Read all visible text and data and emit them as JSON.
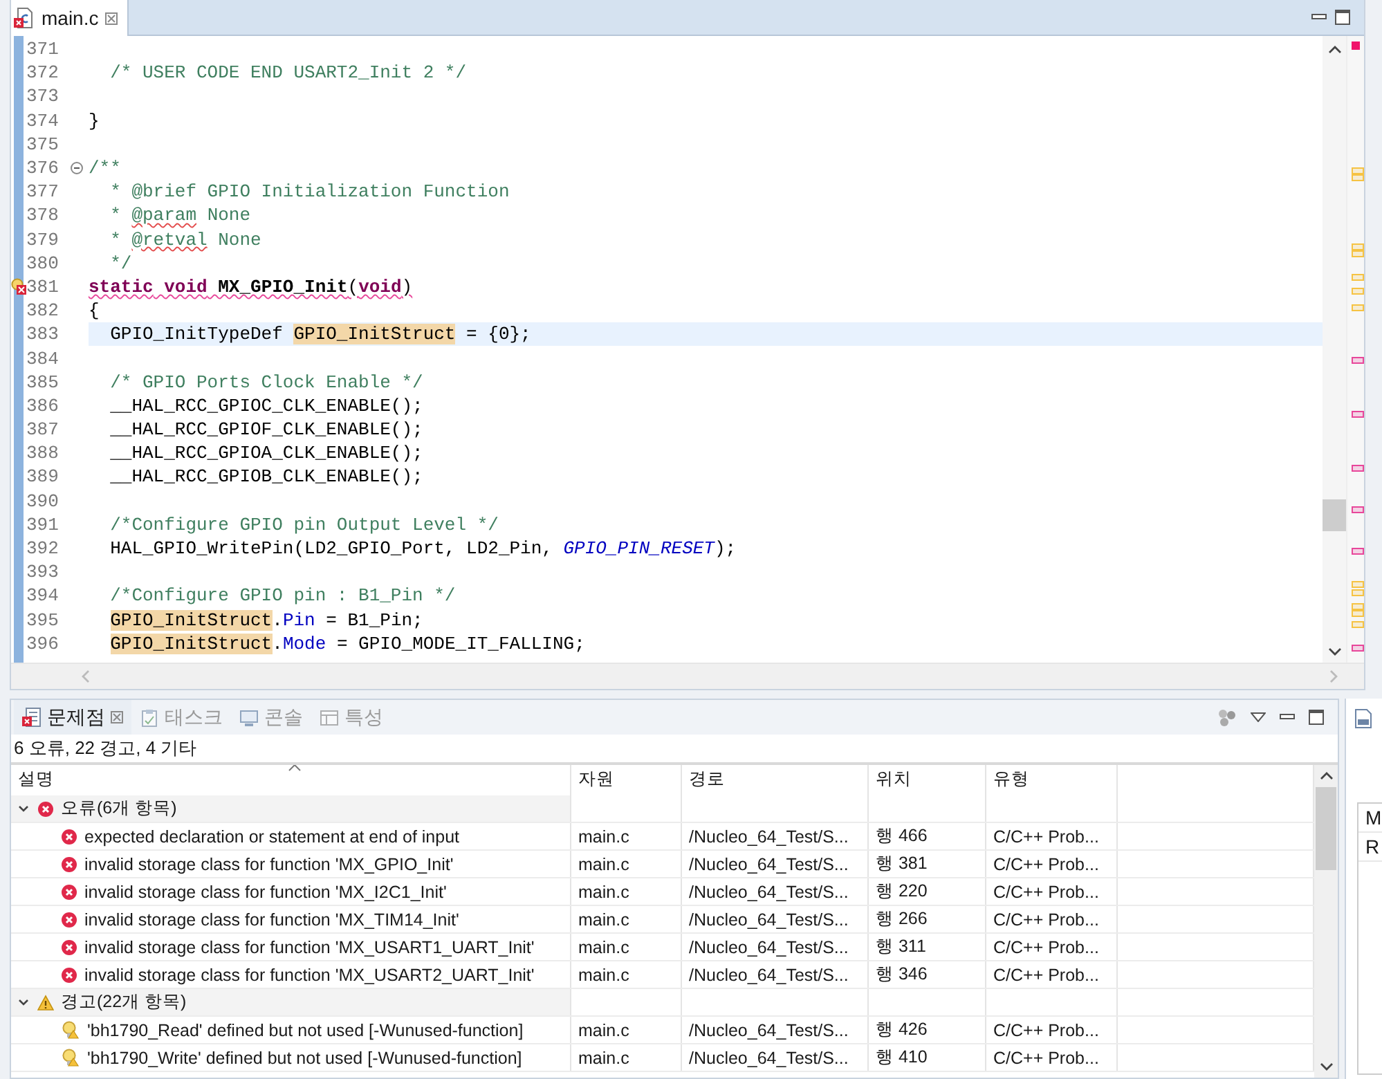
{
  "editor": {
    "tab": {
      "title": "main.c",
      "selected": true
    },
    "lines": [
      {
        "number": "371"
      },
      {
        "number": "372",
        "indented": true,
        "tokens": [
          {
            "text": "/* USER CODE END USART2_Init 2 */",
            "kind": "comment"
          }
        ]
      },
      {
        "number": "373"
      },
      {
        "number": "374",
        "indented": false,
        "tokens": [
          {
            "text": "}",
            "kind": "code"
          }
        ]
      },
      {
        "number": "375"
      },
      {
        "number": "376",
        "foldable": true,
        "indented": false,
        "tokens": [
          {
            "text": "/**",
            "kind": "comment"
          }
        ]
      },
      {
        "number": "377",
        "indented": true,
        "tokens": [
          {
            "text": "* @brief GPIO Initialization Function",
            "kind": "comment"
          }
        ]
      },
      {
        "number": "378",
        "indented": true,
        "tokens": [
          {
            "text": "* ",
            "kind": "comment"
          },
          {
            "text": "@param",
            "kind": "misspelled"
          },
          {
            "text": " None",
            "kind": "comment"
          }
        ]
      },
      {
        "number": "379",
        "indented": true,
        "tokens": [
          {
            "text": "* ",
            "kind": "comment"
          },
          {
            "text": "@retval",
            "kind": "misspelled"
          },
          {
            "text": " None",
            "kind": "comment"
          }
        ]
      },
      {
        "number": "380",
        "indented": true,
        "tokens": [
          {
            "text": "*/",
            "kind": "comment"
          }
        ]
      },
      {
        "number": "381",
        "annotation": true,
        "error": true,
        "indented": false,
        "tokens": [
          {
            "text": "static",
            "kind": "keyword"
          },
          {
            "text": " void",
            "kind": "keyword"
          },
          {
            "text": " MX_GPIO_Init",
            "kind": "declaration"
          },
          {
            "text": "(",
            "kind": "code"
          },
          {
            "text": "void",
            "kind": "keyword"
          },
          {
            "text": ")",
            "kind": "code"
          }
        ]
      },
      {
        "number": "382",
        "indented": false,
        "tokens": [
          {
            "text": "{",
            "kind": "code"
          }
        ]
      },
      {
        "number": "383",
        "current": true,
        "indented": true,
        "tokens": [
          {
            "text": "GPIO_InitTypeDef ",
            "kind": "code"
          },
          {
            "text": "GPIO_InitStruct",
            "kind": "occurrence"
          },
          {
            "text": " = {0};",
            "kind": "code"
          }
        ]
      },
      {
        "number": "384"
      },
      {
        "number": "385",
        "indented": true,
        "tokens": [
          {
            "text": "/* GPIO Ports Clock Enable */",
            "kind": "comment"
          }
        ]
      },
      {
        "number": "386",
        "indented": true,
        "tokens": [
          {
            "text": "__HAL_RCC_GPIOC_CLK_ENABLE();",
            "kind": "code"
          }
        ]
      },
      {
        "number": "387",
        "indented": true,
        "tokens": [
          {
            "text": "__HAL_RCC_GPIOF_CLK_ENABLE();",
            "kind": "code"
          }
        ]
      },
      {
        "number": "388",
        "indented": true,
        "tokens": [
          {
            "text": "__HAL_RCC_GPIOA_CLK_ENABLE();",
            "kind": "code"
          }
        ]
      },
      {
        "number": "389",
        "indented": true,
        "tokens": [
          {
            "text": "__HAL_RCC_GPIOB_CLK_ENABLE();",
            "kind": "code"
          }
        ]
      },
      {
        "number": "390"
      },
      {
        "number": "391",
        "indented": true,
        "tokens": [
          {
            "text": "/*Configure GPIO pin Output Level */",
            "kind": "comment"
          }
        ]
      },
      {
        "number": "392",
        "indented": true,
        "tokens": [
          {
            "text": "HAL_GPIO_WritePin(LD2_GPIO_Port, LD2_Pin, ",
            "kind": "code"
          },
          {
            "text": "GPIO_PIN_RESET",
            "kind": "macro"
          },
          {
            "text": ");",
            "kind": "code"
          }
        ]
      },
      {
        "number": "393"
      },
      {
        "number": "394",
        "indented": true,
        "tokens": [
          {
            "text": "/*Configure GPIO pin : B1_Pin */",
            "kind": "comment"
          }
        ]
      },
      {
        "number": "395",
        "indented": true,
        "tokens": [
          {
            "text": "GPIO_InitStruct",
            "kind": "occurrence"
          },
          {
            "text": ".",
            "kind": "code"
          },
          {
            "text": "Pin",
            "kind": "field"
          },
          {
            "text": " = B1_Pin;",
            "kind": "code"
          }
        ]
      },
      {
        "number": "396",
        "indented": true,
        "tokens": [
          {
            "text": "GPIO_InitStruct",
            "kind": "occurrence"
          },
          {
            "text": ".",
            "kind": "code"
          },
          {
            "text": "Mode",
            "kind": "field"
          },
          {
            "text": " = GPIO_MODE_IT_FALLING;",
            "kind": "code"
          }
        ]
      }
    ]
  },
  "problems_view": {
    "tabs": [
      {
        "label": "문제점",
        "kind": "problems",
        "selected": true
      },
      {
        "label": "태스크",
        "kind": "tasks",
        "selected": false
      },
      {
        "label": "콘솔",
        "kind": "console",
        "selected": false
      },
      {
        "label": "특성",
        "kind": "properties",
        "selected": false
      }
    ],
    "summary": "6 오류, 22 경고, 4 기타",
    "columns": [
      "설명",
      "자원",
      "경로",
      "위치",
      "유형"
    ],
    "groups": [
      {
        "label": "오류(6개 항목)",
        "kind": "error",
        "expanded": true,
        "items": [
          {
            "description": "expected declaration or statement at end of input",
            "resource": "main.c",
            "path": "/Nucleo_64_Test/S...",
            "location": "행 466",
            "type": "C/C++ Prob..."
          },
          {
            "description": "invalid storage class for function 'MX_GPIO_Init'",
            "resource": "main.c",
            "path": "/Nucleo_64_Test/S...",
            "location": "행 381",
            "type": "C/C++ Prob..."
          },
          {
            "description": "invalid storage class for function 'MX_I2C1_Init'",
            "resource": "main.c",
            "path": "/Nucleo_64_Test/S...",
            "location": "행 220",
            "type": "C/C++ Prob..."
          },
          {
            "description": "invalid storage class for function 'MX_TIM14_Init'",
            "resource": "main.c",
            "path": "/Nucleo_64_Test/S...",
            "location": "행 266",
            "type": "C/C++ Prob..."
          },
          {
            "description": "invalid storage class for function 'MX_USART1_UART_Init'",
            "resource": "main.c",
            "path": "/Nucleo_64_Test/S...",
            "location": "행 311",
            "type": "C/C++ Prob..."
          },
          {
            "description": "invalid storage class for function 'MX_USART2_UART_Init'",
            "resource": "main.c",
            "path": "/Nucleo_64_Test/S...",
            "location": "행 346",
            "type": "C/C++ Prob..."
          }
        ]
      },
      {
        "label": "경고(22개 항목)",
        "kind": "warning",
        "expanded": true,
        "items": [
          {
            "description": "'bh1790_Read' defined but not used [-Wunused-function]",
            "resource": "main.c",
            "path": "/Nucleo_64_Test/S...",
            "location": "행 426",
            "type": "C/C++ Prob..."
          },
          {
            "description": "'bh1790_Write' defined but not used [-Wunused-function]",
            "resource": "main.c",
            "path": "/Nucleo_64_Test/S...",
            "location": "행 410",
            "type": "C/C++ Prob..."
          }
        ]
      }
    ]
  },
  "side_panel": {
    "rows": [
      "M",
      "R"
    ]
  }
}
